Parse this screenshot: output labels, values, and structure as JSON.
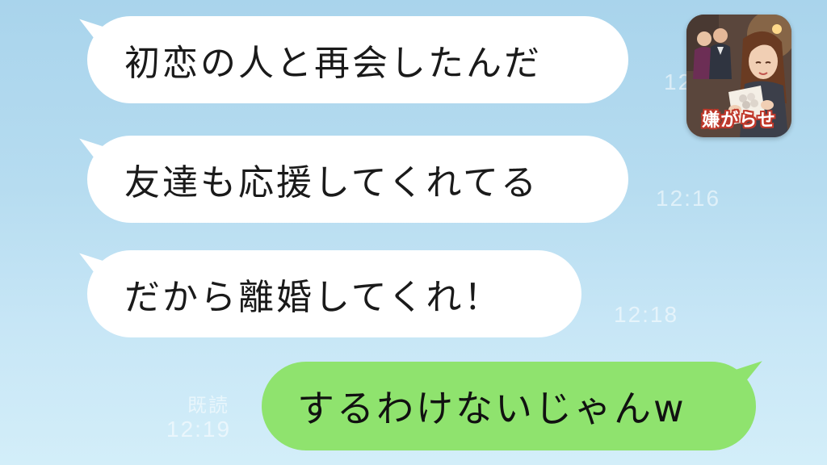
{
  "app_icon": {
    "label": "嫌がらせ"
  },
  "messages": [
    {
      "side": "incoming",
      "text": "初恋の人と再会したんだ",
      "time": "12:05"
    },
    {
      "side": "incoming",
      "text": "友達も応援してくれてる",
      "time": "12:16"
    },
    {
      "side": "incoming",
      "text": "だから離婚してくれ！",
      "time": "12:18"
    },
    {
      "side": "outgoing",
      "text": "するわけないじゃんw",
      "time": "12:19",
      "status": "既読"
    }
  ],
  "colors": {
    "incoming_bubble": "#ffffff",
    "outgoing_bubble": "#8fe36e",
    "background": "#b6dcf0"
  }
}
